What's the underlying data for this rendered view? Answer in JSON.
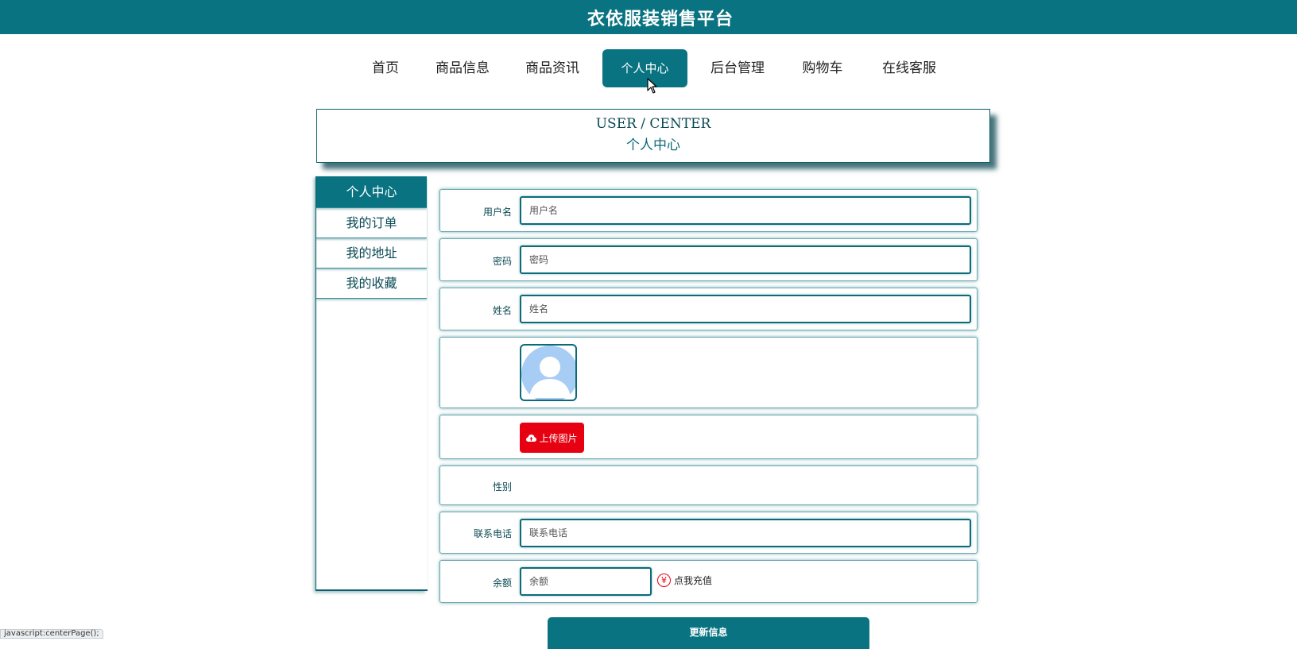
{
  "app": {
    "title": "衣依服装销售平台"
  },
  "nav": {
    "items": [
      {
        "label": "首页",
        "active": false
      },
      {
        "label": "商品信息",
        "active": false
      },
      {
        "label": "商品资讯",
        "active": false
      },
      {
        "label": "个人中心",
        "active": true
      },
      {
        "label": "后台管理",
        "active": false
      },
      {
        "label": "购物车",
        "active": false
      },
      {
        "label": "在线客服",
        "active": false
      }
    ]
  },
  "header": {
    "en": "USER / CENTER",
    "cn": "个人中心"
  },
  "sidebar": {
    "items": [
      {
        "label": "个人中心",
        "active": true
      },
      {
        "label": "我的订单",
        "active": false
      },
      {
        "label": "我的地址",
        "active": false
      },
      {
        "label": "我的收藏",
        "active": false
      }
    ]
  },
  "form": {
    "username": {
      "label": "用户名",
      "placeholder": "用户名",
      "value": ""
    },
    "password": {
      "label": "密码",
      "placeholder": "密码",
      "value": ""
    },
    "name": {
      "label": "姓名",
      "placeholder": "姓名",
      "value": ""
    },
    "avatar": {
      "icon": "default-user-avatar"
    },
    "upload": {
      "label": "上传图片",
      "icon": "cloud-upload-icon"
    },
    "gender": {
      "label": "性别",
      "value": ""
    },
    "phone": {
      "label": "联系电话",
      "placeholder": "联系电话",
      "value": ""
    },
    "balance": {
      "label": "余额",
      "placeholder": "余额",
      "value": ""
    },
    "recharge": {
      "label": "点我充值",
      "icon": "yen-icon",
      "symbol": "¥"
    },
    "submit_label": "更新信息"
  },
  "statusbar": {
    "text": "javascript:centerPage();"
  },
  "colors": {
    "primary": "#097381",
    "danger": "#e60012",
    "avatar": "#a8cdf5"
  }
}
